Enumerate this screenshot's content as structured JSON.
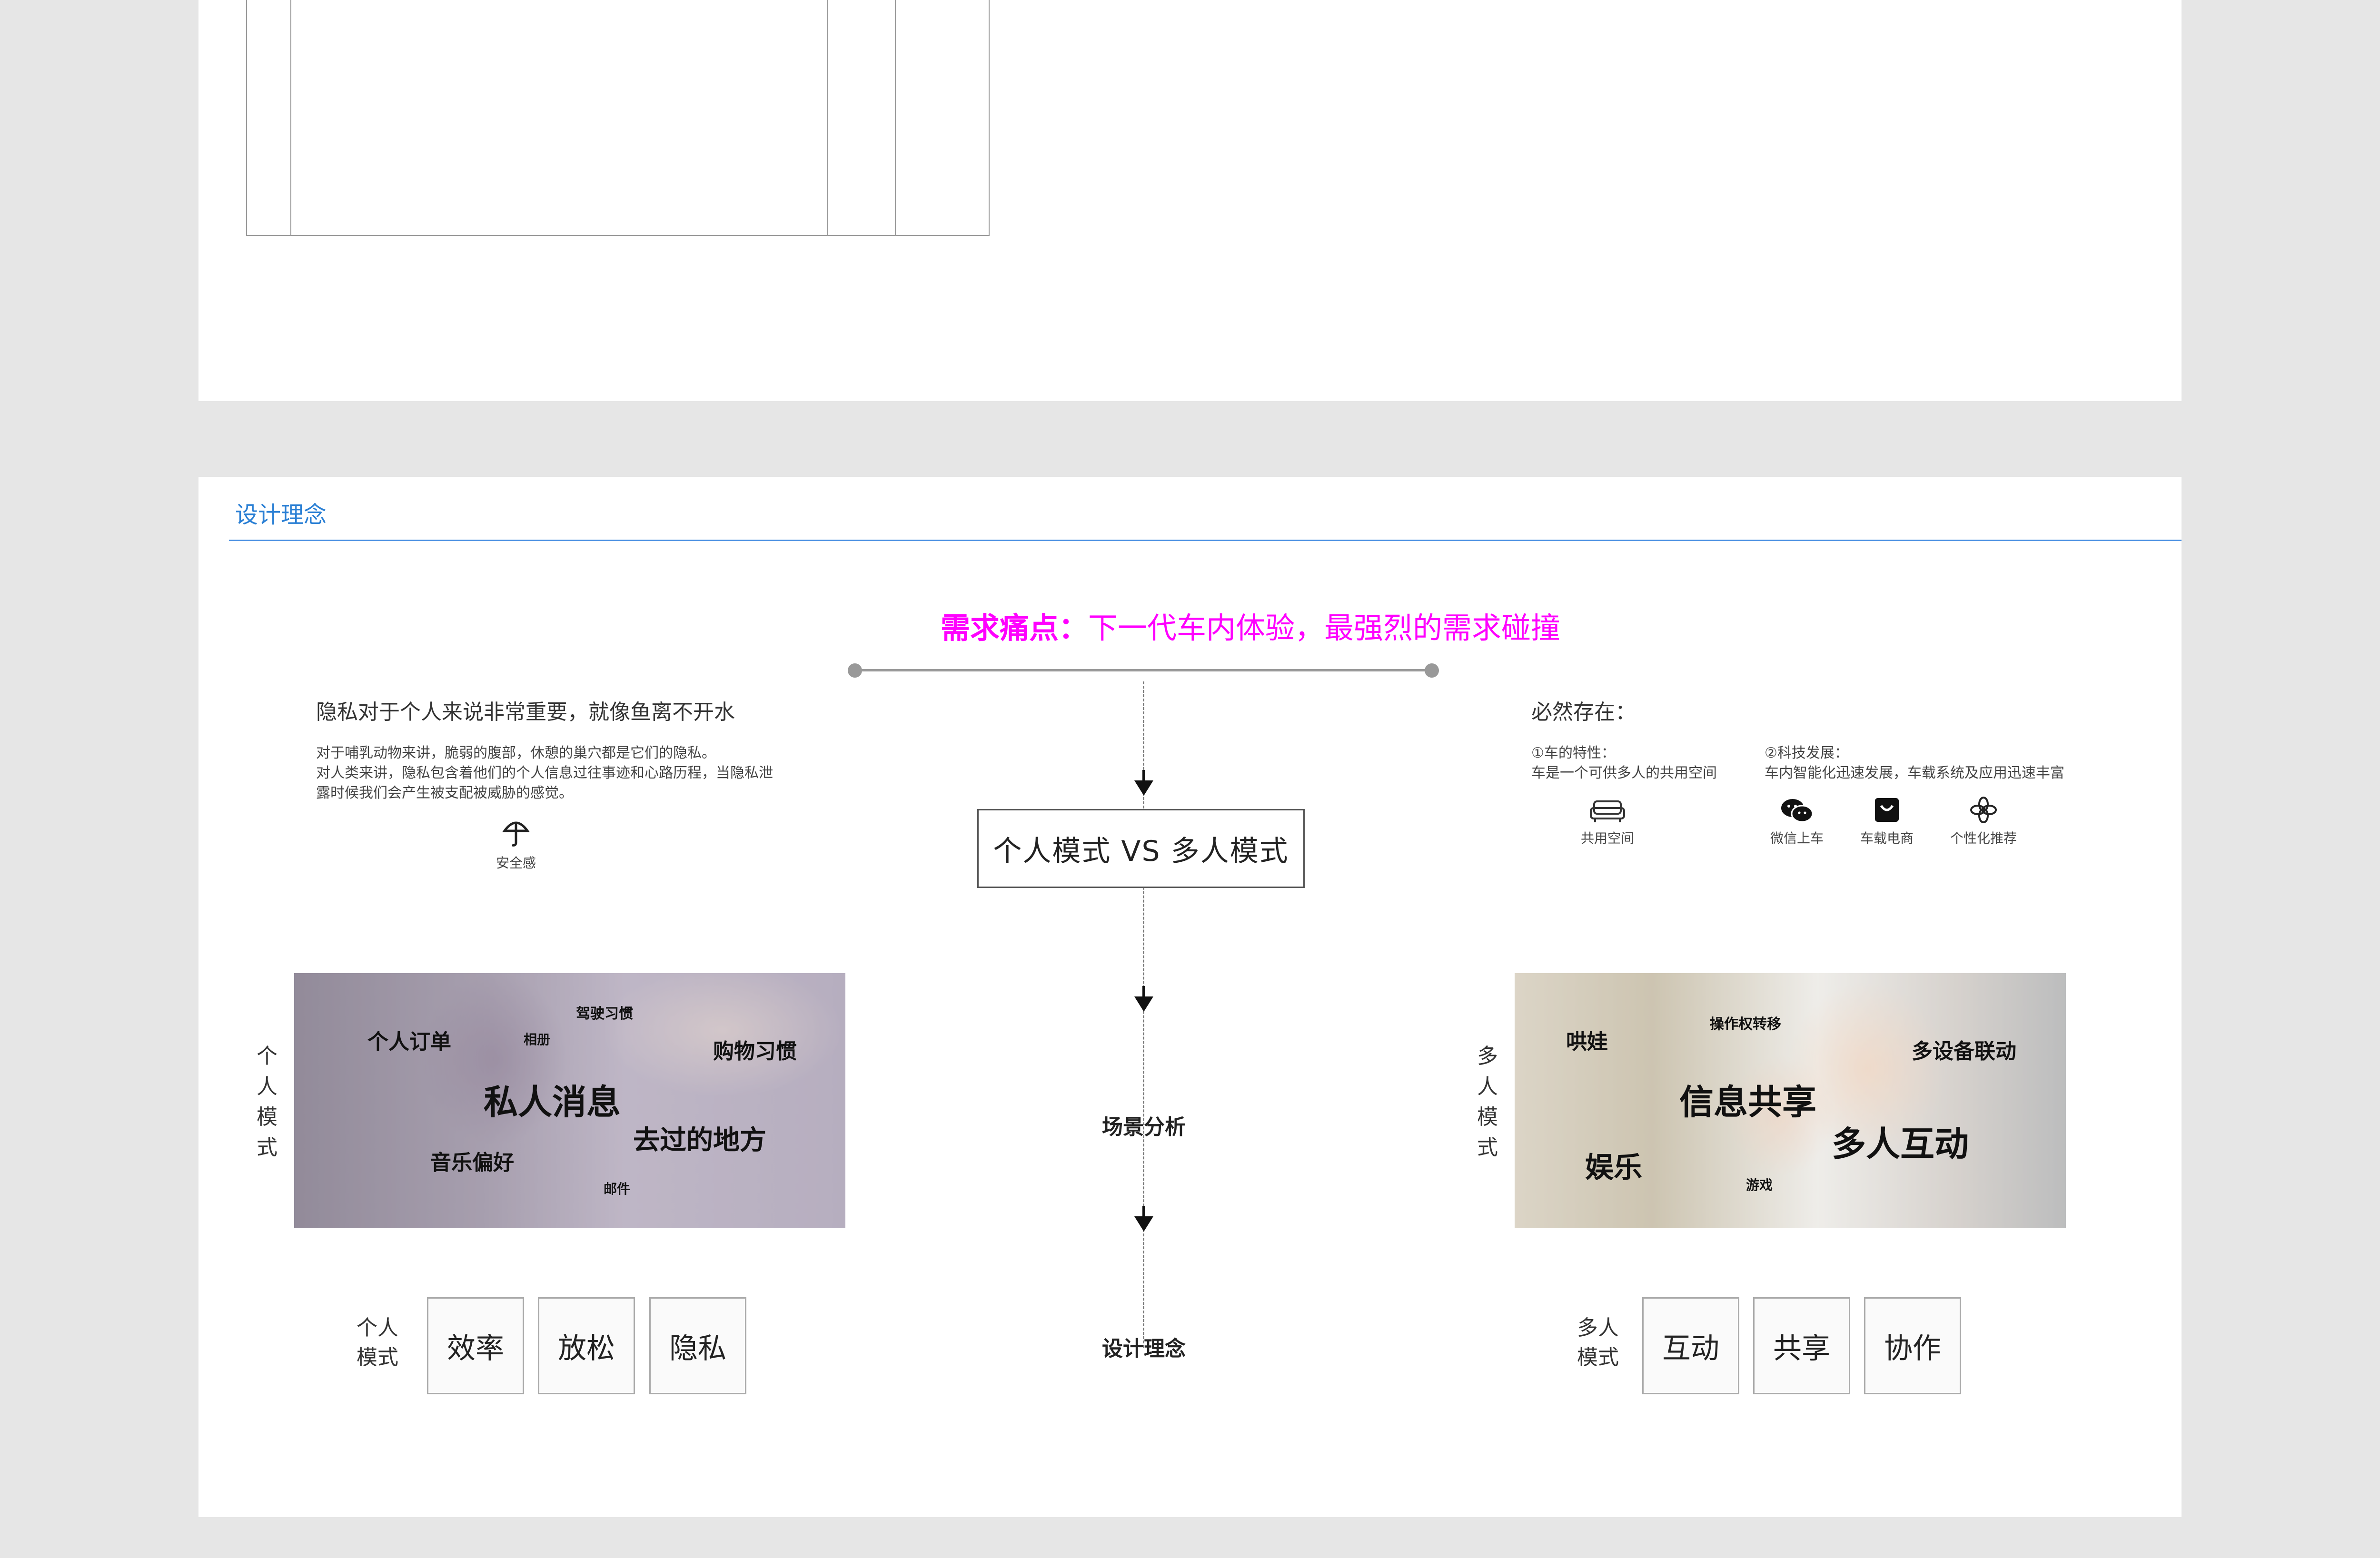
{
  "section": {
    "title": "设计理念"
  },
  "pain_point": {
    "label": "需求痛点：",
    "text": "下一代车内体验，最强烈的需求碰撞"
  },
  "center": {
    "vs_text": "个人模式 VS 多人模式",
    "scene_label": "场景分析",
    "design_label": "设计理念"
  },
  "left": {
    "heading": "隐私对于个人来说非常重要，就像鱼离不开水",
    "body_lines": [
      "对于哺乳动物来讲，脆弱的腹部，休憩的巢穴都是它们的隐私。",
      "对人类来讲，隐私包含着他们的个人信息过往事迹和心路历程，当隐私泄",
      "露时候我们会产生被支配被威胁的感觉。"
    ],
    "icon_name": "umbrella-icon",
    "icon_label": "安全感",
    "mode_vertical": [
      "个",
      "人",
      "模",
      "式"
    ],
    "mode_label_lines": [
      "个人",
      "模式"
    ],
    "words": {
      "w1": "驾驶习惯",
      "w2": "个人订单",
      "w3": "相册",
      "w4": "购物习惯",
      "w5": "私人消息",
      "w6": "去过的地方",
      "w7": "音乐偏好",
      "w8": "邮件"
    },
    "keywords": [
      "效率",
      "放松",
      "隐私"
    ]
  },
  "right": {
    "heading": "必然存在：",
    "col1_title": "①车的特性：",
    "col1_text": "车是一个可供多人的共用空间",
    "col2_title": "②科技发展：",
    "col2_text": "车内智能化迅速发展，车载系统及应用迅速丰富",
    "icons": [
      {
        "name": "sofa-icon",
        "label": "共用空间"
      },
      {
        "name": "wechat-icon",
        "label": "微信上车"
      },
      {
        "name": "shopping-bag-icon",
        "label": "车载电商"
      },
      {
        "name": "flower-icon",
        "label": "个性化推荐"
      }
    ],
    "mode_vertical": [
      "多",
      "人",
      "模",
      "式"
    ],
    "mode_label_lines": [
      "多人",
      "模式"
    ],
    "words": {
      "w1": "操作权转移",
      "w2": "哄娃",
      "w3": "多设备联动",
      "w4": "信息共享",
      "w5": "多人互动",
      "w6": "娱乐",
      "w7": "游戏"
    },
    "keywords": [
      "互动",
      "共享",
      "协作"
    ]
  }
}
